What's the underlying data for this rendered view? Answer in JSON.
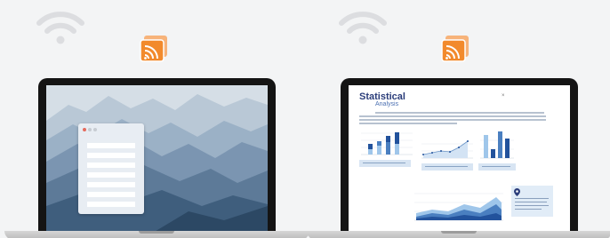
{
  "document": {
    "title": "Statistical",
    "subtitle": "Analysis",
    "close_glyph": "×"
  },
  "icons": {
    "wifi": "wifi-icon",
    "cast": "screen-cast-icon"
  },
  "colors": {
    "background": "#f3f4f5",
    "cast_orange": "#f28a2c",
    "doc_title_blue": "#2b3d7a",
    "chart_dark_blue": "#22529c",
    "chart_light_blue": "#9fc6ea"
  }
}
